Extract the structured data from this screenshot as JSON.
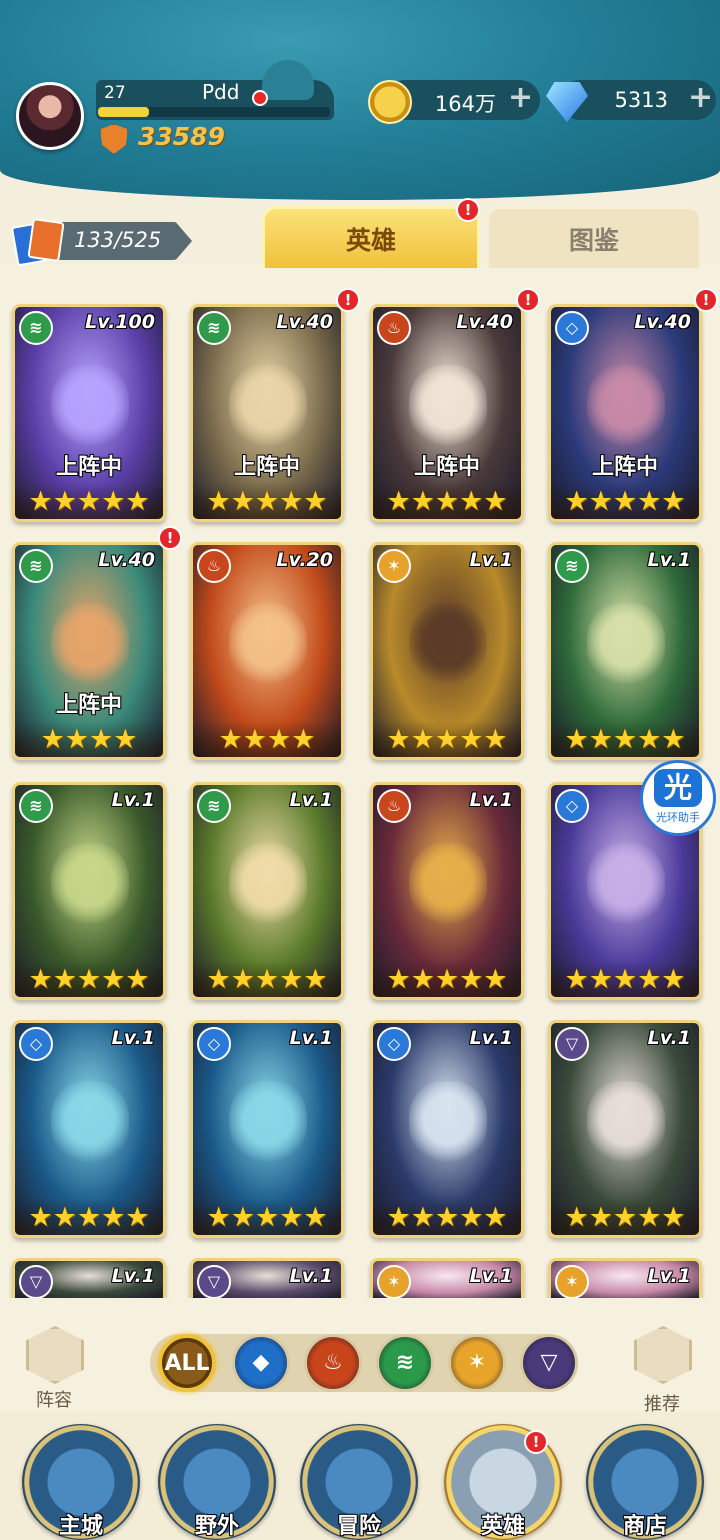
{
  "player": {
    "level": "27",
    "name": "Pdd",
    "xp_fraction": 0.22,
    "power": "33589"
  },
  "currency": {
    "gold": "164万",
    "diamonds": "5313",
    "plus": "+"
  },
  "collection": {
    "count": "133/525"
  },
  "tabs": {
    "heroes": "英雄",
    "codex": "图鉴",
    "badge": "!"
  },
  "heroes": [
    {
      "level": "Lv.100",
      "faction": "forest",
      "status": "上阵中",
      "stars": "★★★★★",
      "stars_count": 5,
      "alert": false,
      "art": "#5b3fa8",
      "accent": "#b7a4ff"
    },
    {
      "level": "Lv.40",
      "faction": "forest",
      "status": "上阵中",
      "stars": "★★★★★",
      "stars_count": 5,
      "alert": true,
      "art": "#7a6b4c",
      "accent": "#e9d6a8"
    },
    {
      "level": "Lv.40",
      "faction": "fire",
      "status": "上阵中",
      "stars": "★★★★★",
      "stars_count": 5,
      "alert": true,
      "art": "#4a3a3a",
      "accent": "#f3e6d8"
    },
    {
      "level": "Lv.40",
      "faction": "water",
      "status": "上阵中",
      "stars": "★★★★★",
      "stars_count": 5,
      "alert": true,
      "art": "#2b3a7a",
      "accent": "#c98aa8"
    },
    {
      "level": "Lv.40",
      "faction": "forest",
      "status": "上阵中",
      "stars": "★★★★",
      "stars_count": 4,
      "alert": true,
      "art": "#3a8a7a",
      "accent": "#e7a46a"
    },
    {
      "level": "Lv.20",
      "faction": "fire",
      "status": "",
      "stars": "★★★★",
      "stars_count": 4,
      "alert": false,
      "art": "#c24a1a",
      "accent": "#f4c28a"
    },
    {
      "level": "Lv.1",
      "faction": "light",
      "status": "",
      "stars": "★★★★★",
      "stars_count": 5,
      "alert": false,
      "art": "#b88a2a",
      "accent": "#5a3a28"
    },
    {
      "level": "Lv.1",
      "faction": "forest",
      "status": "",
      "stars": "★★★★★",
      "stars_count": 5,
      "alert": false,
      "art": "#2e6a3a",
      "accent": "#d8e0a8"
    },
    {
      "level": "Lv.1",
      "faction": "forest",
      "status": "",
      "stars": "★★★★★",
      "stars_count": 5,
      "alert": false,
      "art": "#3a5a2a",
      "accent": "#c8d88a"
    },
    {
      "level": "Lv.1",
      "faction": "forest",
      "status": "",
      "stars": "★★★★★",
      "stars_count": 5,
      "alert": false,
      "art": "#5a7a2a",
      "accent": "#f0dca8"
    },
    {
      "level": "Lv.1",
      "faction": "fire",
      "status": "",
      "stars": "★★★★★",
      "stars_count": 5,
      "alert": false,
      "art": "#6a2a3a",
      "accent": "#e8b04a"
    },
    {
      "level": "Lv.1",
      "faction": "water",
      "status": "",
      "stars": "★★★★★",
      "stars_count": 5,
      "alert": false,
      "art": "#4a3a9a",
      "accent": "#c8b0e8"
    },
    {
      "level": "Lv.1",
      "faction": "water",
      "status": "",
      "stars": "★★★★★",
      "stars_count": 5,
      "alert": false,
      "art": "#1a5a8a",
      "accent": "#8ad8e8"
    },
    {
      "level": "Lv.1",
      "faction": "water",
      "status": "",
      "stars": "★★★★★",
      "stars_count": 5,
      "alert": false,
      "art": "#1a5a8a",
      "accent": "#8ad8e8"
    },
    {
      "level": "Lv.1",
      "faction": "water",
      "status": "",
      "stars": "★★★★★",
      "stars_count": 5,
      "alert": false,
      "art": "#2a3a6a",
      "accent": "#d8e4f0"
    },
    {
      "level": "Lv.1",
      "faction": "dark",
      "status": "",
      "stars": "★★★★★",
      "stars_count": 5,
      "alert": false,
      "art": "#3a4a3a",
      "accent": "#e8e0d8"
    },
    {
      "level": "Lv.1",
      "faction": "dark",
      "status": "",
      "stars": "",
      "stars_count": 0,
      "alert": false,
      "art": "#3a4a3a",
      "accent": "#e8e0d8"
    },
    {
      "level": "Lv.1",
      "faction": "dark",
      "status": "",
      "stars": "",
      "stars_count": 0,
      "alert": false,
      "art": "#5a4a6a",
      "accent": "#e8e0d8"
    },
    {
      "level": "Lv.1",
      "faction": "light",
      "status": "",
      "stars": "",
      "stars_count": 0,
      "alert": false,
      "art": "#c88aa8",
      "accent": "#f8e8f0"
    },
    {
      "level": "Lv.1",
      "faction": "light",
      "status": "",
      "stars": "",
      "stars_count": 0,
      "alert": false,
      "art": "#c88aa8",
      "accent": "#f8e8f0"
    }
  ],
  "helper_badge": {
    "glyph": "光",
    "label": "光环助手"
  },
  "filters": {
    "left_label": "阵容",
    "right_label": "推荐",
    "items": [
      {
        "name": "all",
        "text": "ALL",
        "color": "#8a5a1a",
        "selected": true
      },
      {
        "name": "water",
        "text": "",
        "color": "#1f6fc8",
        "selected": false
      },
      {
        "name": "fire",
        "text": "",
        "color": "#c8441a",
        "selected": false
      },
      {
        "name": "forest",
        "text": "",
        "color": "#2a9a4a",
        "selected": false
      },
      {
        "name": "light",
        "text": "",
        "color": "#e8a42a",
        "selected": false
      },
      {
        "name": "dark",
        "text": "",
        "color": "#4a3a7a",
        "selected": false
      }
    ]
  },
  "faction_colors": {
    "forest": "#2f9a4a",
    "fire": "#c9461c",
    "water": "#2a78d8",
    "light": "#e6a22a",
    "dark": "#5a4a8a"
  },
  "nav": [
    {
      "label": "主城",
      "active": false,
      "alert": false
    },
    {
      "label": "野外",
      "active": false,
      "alert": false
    },
    {
      "label": "冒险",
      "active": false,
      "alert": false
    },
    {
      "label": "英雄",
      "active": true,
      "alert": true
    },
    {
      "label": "商店",
      "active": false,
      "alert": false
    }
  ]
}
